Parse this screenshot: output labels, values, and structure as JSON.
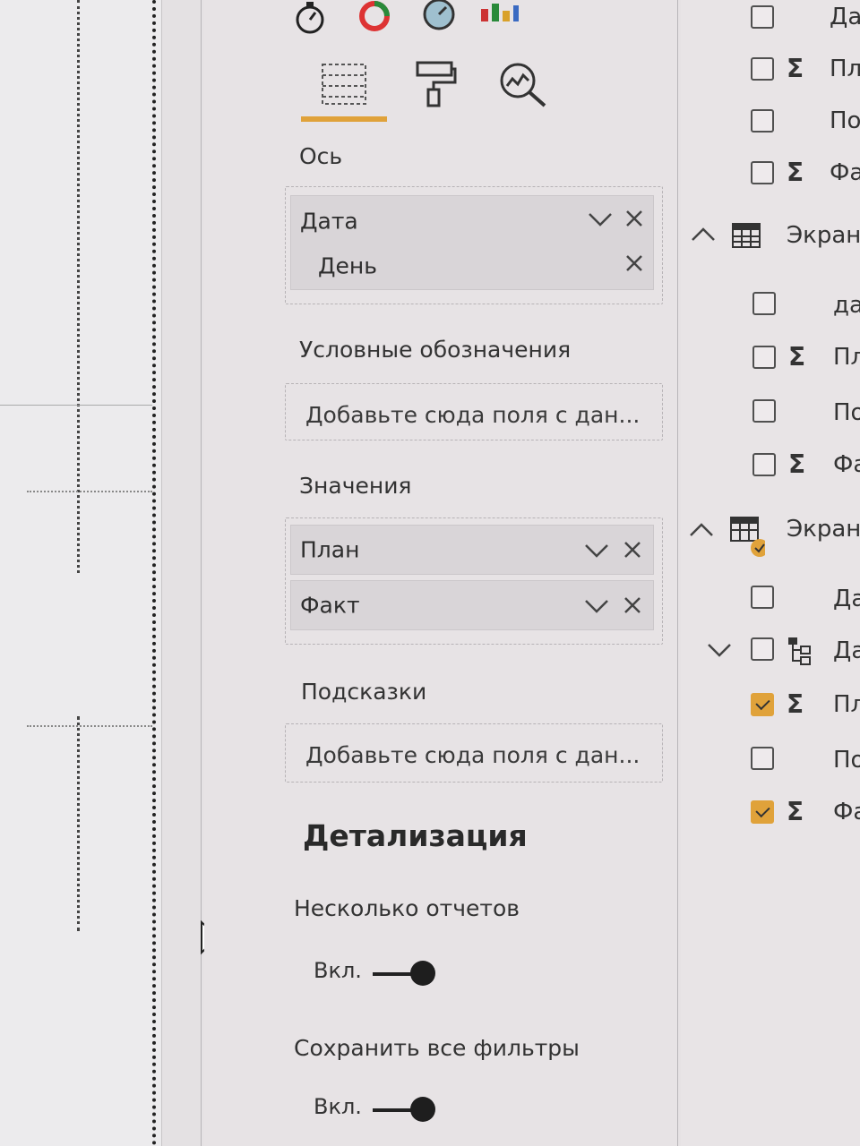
{
  "visualization_pane": {
    "tabs": [
      {
        "name": "fields-tab",
        "active": true
      },
      {
        "name": "format-tab",
        "active": false
      },
      {
        "name": "analytics-tab",
        "active": false
      }
    ],
    "axis": {
      "label": "Ось",
      "items": [
        {
          "label": "Дата"
        },
        {
          "label": "День"
        }
      ]
    },
    "legend": {
      "label": "Условные обозначения",
      "placeholder": "Добавьте сюда поля с дан..."
    },
    "values": {
      "label": "Значения",
      "items": [
        {
          "label": "План"
        },
        {
          "label": "Факт"
        }
      ]
    },
    "tooltips": {
      "label": "Подсказки",
      "placeholder": "Добавьте сюда поля с дан..."
    },
    "drillthrough": {
      "heading": "Детализация",
      "cross_report": {
        "label": "Несколько отчетов",
        "state": "Вкл."
      },
      "keep_filters": {
        "label": "Сохранить все фильтры",
        "state": "Вкл."
      }
    }
  },
  "fields_pane": {
    "group1": {
      "items": [
        {
          "label": "Да",
          "checked": false,
          "sigma": false
        },
        {
          "label": "Пл",
          "checked": false,
          "sigma": true
        },
        {
          "label": "По",
          "checked": false,
          "sigma": false
        },
        {
          "label": "Фа",
          "checked": false,
          "sigma": true
        }
      ]
    },
    "table2": {
      "label": "Экран",
      "expanded": true,
      "items": [
        {
          "label": "да",
          "checked": false,
          "sigma": false
        },
        {
          "label": "Пл",
          "checked": false,
          "sigma": true
        },
        {
          "label": "По",
          "checked": false,
          "sigma": false
        },
        {
          "label": "Фа",
          "checked": false,
          "sigma": true
        }
      ]
    },
    "table3": {
      "label": "Экран",
      "expanded": true,
      "items": [
        {
          "label": "Да",
          "checked": false,
          "sigma": false
        },
        {
          "label": "Да",
          "checked": false,
          "hierarchy": true
        },
        {
          "label": "Пл",
          "checked": true,
          "sigma": true
        },
        {
          "label": "По",
          "checked": false,
          "sigma": false
        },
        {
          "label": "Фа",
          "checked": true,
          "sigma": true
        }
      ]
    }
  },
  "colors": {
    "accent": "#e0a23a",
    "active_tab_underline": "#e0a23a"
  }
}
